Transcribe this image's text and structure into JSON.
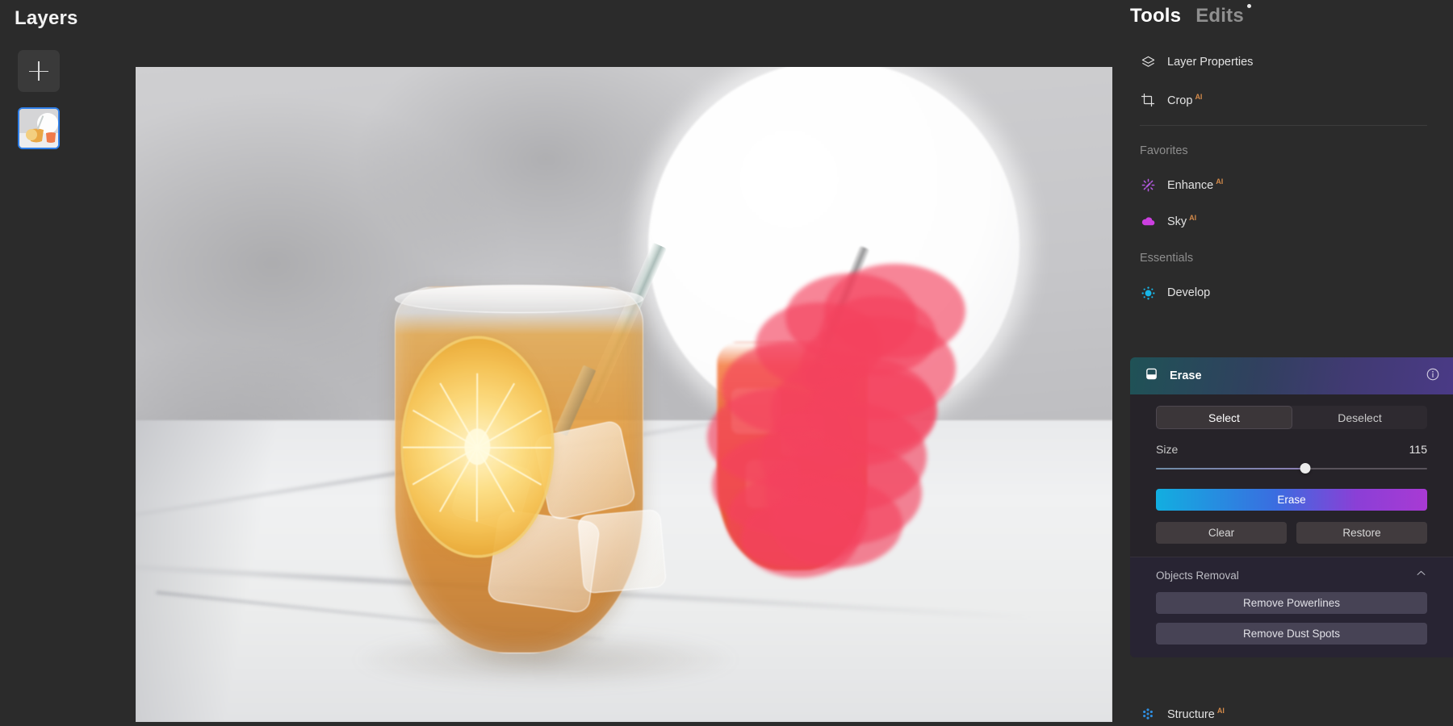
{
  "layers_panel": {
    "title": "Layers",
    "add_button_icon": "plus-icon",
    "layer_thumbnail_name": "layer-thumbnail"
  },
  "tools_panel": {
    "tabs": [
      {
        "label": "Tools",
        "active": true
      },
      {
        "label": "Edits",
        "active": false,
        "has_dot": true
      }
    ],
    "top_tools": [
      {
        "label": "Layer Properties",
        "icon": "layers-stack-icon",
        "ai": false
      },
      {
        "label": "Crop",
        "icon": "crop-icon",
        "ai": true
      }
    ],
    "sections": [
      {
        "label": "Favorites",
        "items": [
          {
            "label": "Enhance",
            "icon": "sparkle-icon",
            "ai": true,
            "color": "#b45ae0"
          },
          {
            "label": "Sky",
            "icon": "cloud-icon",
            "ai": true,
            "color": "#cc3fe0"
          }
        ]
      },
      {
        "label": "Essentials",
        "items": [
          {
            "label": "Develop",
            "icon": "aperture-sun-icon",
            "ai": false,
            "color": "#18b6e8"
          }
        ]
      }
    ],
    "bottom_tools": [
      {
        "label": "Structure",
        "icon": "dot-cluster-icon",
        "ai": true,
        "color": "#2f8ee0"
      }
    ],
    "ai_badge_text": "AI",
    "erase_panel": {
      "title": "Erase",
      "icon": "eraser-icon",
      "info_icon": "info-icon",
      "mode_tabs": [
        {
          "label": "Select",
          "active": true
        },
        {
          "label": "Deselect",
          "active": false
        }
      ],
      "size": {
        "label": "Size",
        "value": "115",
        "percent": 55
      },
      "primary_button": "Erase",
      "secondary_buttons": [
        "Clear",
        "Restore"
      ],
      "objects_removal": {
        "title": "Objects Removal",
        "collapse_icon": "chevron-up-icon",
        "buttons": [
          "Remove Powerlines",
          "Remove Dust Spots"
        ]
      }
    }
  },
  "canvas": {
    "image_alt": "Blurred photo of an iced citrus cocktail in a stemless glass on a marble counter with a white circular backdrop",
    "mask_color": "#f4425e",
    "mask_opacity": 0.64
  }
}
